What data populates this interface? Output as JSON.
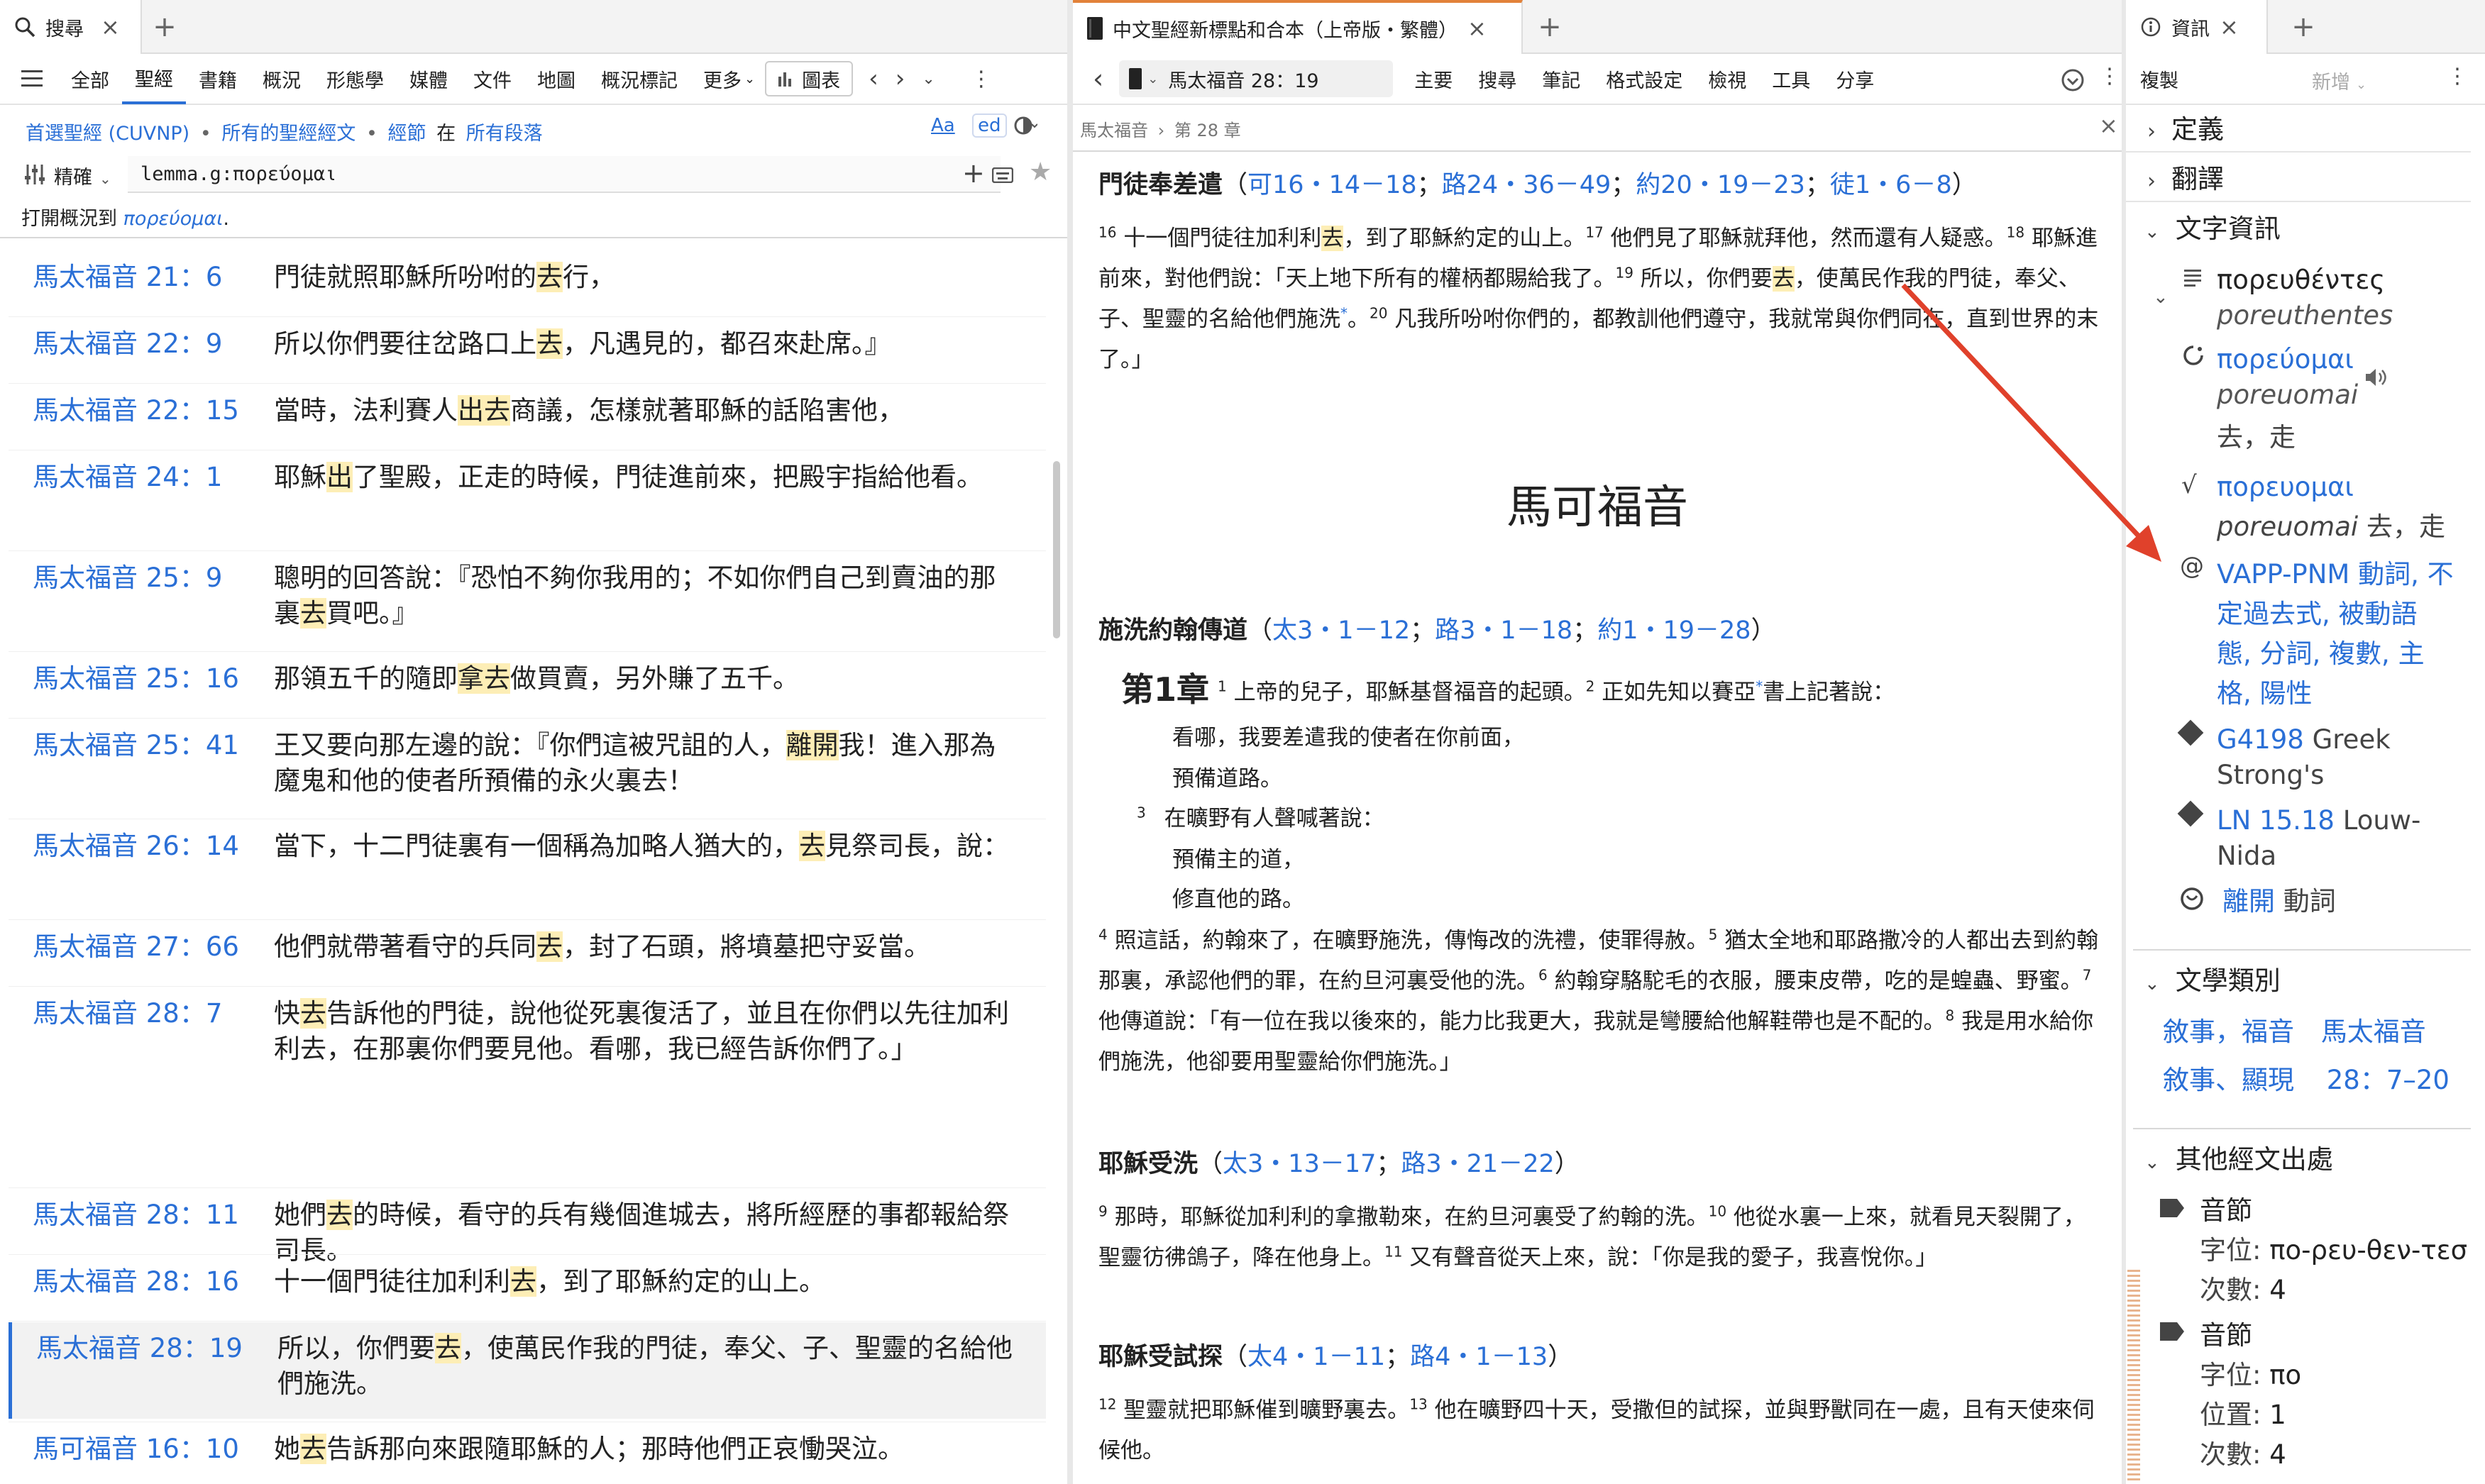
{
  "left": {
    "tab_label": "搜尋",
    "menu": [
      "全部",
      "聖經",
      "書籍",
      "概況",
      "形態學",
      "媒體",
      "文件",
      "地圖",
      "概況標記",
      "更多"
    ],
    "chart_label": "圖表",
    "scope": {
      "bible": "首選聖經 (CUVNP)",
      "sep1": "•",
      "texts": "所有的聖經經文",
      "sep2": "•",
      "scripture": "經節",
      "in": "在",
      "para": "所有段落"
    },
    "aa": "Aa",
    "ed": "ed",
    "search_mode": "精確",
    "query": "lemma.g:πορεύομαι",
    "open_prefix": "打開概況到",
    "open_word": "πορεύομαι",
    "open_suffix": ".",
    "results": [
      {
        "ref": "馬太福音 21：6",
        "pre": "門徒就照耶穌所吩咐的",
        "hl": "去",
        "post": "行，"
      },
      {
        "ref": "馬太福音 22：9",
        "pre": "所以你們要往岔路口上",
        "hl": "去",
        "post": "，凡遇見的，都召來赴席。』"
      },
      {
        "ref": "馬太福音 22：15",
        "pre": "當時，法利賽人",
        "hl": "出去",
        "post": "商議，怎樣就著耶穌的話陷害他，"
      },
      {
        "ref": "馬太福音 24：1",
        "pre": "耶穌",
        "hl": "出",
        "post": "了聖殿，正走的時候，門徒進前來，把殿宇指給他看。"
      },
      {
        "ref": "馬太福音 25：9",
        "pre": "聰明的回答說：『恐怕不夠你我用的；不如你們自己到賣油的那裏",
        "hl": "去",
        "post": "買吧。』"
      },
      {
        "ref": "馬太福音 25：16",
        "pre": "那領五千的隨即",
        "hl": "拿去",
        "post": "做買賣，另外賺了五千。"
      },
      {
        "ref": "馬太福音 25：41",
        "pre": "王又要向那左邊的說：『你們這被咒詛的人，",
        "hl": "離開",
        "post": "我！進入那為魔鬼和他的使者所預備的永火裏去！"
      },
      {
        "ref": "馬太福音 26：14",
        "pre": "當下，十二門徒裏有一個稱為加略人猶大的，",
        "hl": "去",
        "post": "見祭司長，說："
      },
      {
        "ref": "馬太福音 27：66",
        "pre": "他們就帶著看守的兵同",
        "hl": "去",
        "post": "，封了石頭，將墳墓把守妥當。"
      },
      {
        "ref": "馬太福音 28：7",
        "pre": "快",
        "hl": "去",
        "post": "告訴他的門徒，說他從死裏復活了，並且在你們以先往加利利去，在那裏你們要見他。看哪，我已經告訴你們了。」"
      },
      {
        "ref": "馬太福音 28：11",
        "pre": "她們",
        "hl": "去",
        "post": "的時候，看守的兵有幾個進城去，將所經歷的事都報給祭司長。"
      },
      {
        "ref": "馬太福音 28：16",
        "pre": "十一個門徒往加利利",
        "hl": "去",
        "post": "，到了耶穌約定的山上。"
      },
      {
        "ref": "馬太福音 28：19",
        "pre": "所以，你們要",
        "hl": "去",
        "post": "，使萬民作我的門徒，奉父、子、聖靈的名給他們施洗。"
      },
      {
        "ref": "馬可福音 16：10",
        "pre": "她",
        "hl": "去",
        "post": "告訴那向來跟隨耶穌的人；那時他們正哀慟哭泣。"
      }
    ]
  },
  "middle": {
    "tab_label": "中文聖經新標點和合本（上帝版・繁體）",
    "ref_box": "馬太福音 28：19",
    "menu": [
      "主要",
      "搜尋",
      "筆記",
      "格式設定",
      "檢視",
      "工具",
      "分享"
    ],
    "breadcrumb": [
      "馬太福音",
      "第 28 章"
    ],
    "sec1_title": "門徒奉差遣",
    "sec1_refs": [
      "可16・14－18",
      "路24・36－49",
      "約20・19－23",
      "徒1・6－8"
    ],
    "p1": {
      "v16": "16",
      "t16a": "十一個門徒往加利利",
      "h16": "去",
      "t16b": "，到了耶穌約定的山上。",
      "v17": "17",
      "t17": "他們見了耶穌就拜他，然而還有人疑惑。",
      "v18": "18",
      "t18": "耶穌進前來，對他們說：「天上地下所有的權柄都賜給我了。",
      "v19": "19",
      "t19a": "所以，你們要",
      "h19": "去",
      "t19b": "，使萬民作我的門徒，奉父、子、聖靈的名給他們施洗",
      "star": "*",
      "t19c": "。",
      "v20": "20",
      "t20": "凡我所吩咐你們的，都教訓他們遵守，我就常與你們同在，直到世界的末了。」"
    },
    "book_title": "馬可福音",
    "sec2_title": "施洗約翰傳道",
    "sec2_refs": [
      "太3・1－12",
      "路3・1－18",
      "約1・19－28"
    ],
    "chapter_label": "第1章",
    "ch1": {
      "v1": "1",
      "t1": "上帝的兒子，耶穌基督福音的起頭。",
      "v2": "2",
      "t2a": "正如先知以賽亞",
      "star": "*",
      "t2b": "書上記著說：",
      "q1": "看哪，我要差遣我的使者在你前面，",
      "q2": "預備道路。",
      "v3": "3",
      "q3": "在曠野有人聲喊著說：",
      "q4": "預備主的道，",
      "q5": "修直他的路。",
      "v4": "4",
      "t4": "照這話，約翰來了，在曠野施洗，傳悔改的洗禮，使罪得赦。",
      "v5": "5",
      "t5": "猶太全地和耶路撒冷的人都出去到約翰那裏，承認他們的罪，在約旦河裏受他的洗。",
      "v6": "6",
      "t6": "約翰穿駱駝毛的衣服，腰束皮帶，吃的是蝗蟲、野蜜。",
      "v7": "7",
      "t7": "他傳道說：「有一位在我以後來的，能力比我更大，我就是彎腰給他解鞋帶也是不配的。",
      "v8": "8",
      "t8": "我是用水給你們施洗，他卻要用聖靈給你們施洗。」"
    },
    "sec3_title": "耶穌受洗",
    "sec3_refs": [
      "太3・13－17",
      "路3・21－22"
    ],
    "p3": {
      "v9": "9",
      "t9": "那時，耶穌從加利利的拿撒勒來，在約旦河裏受了約翰的洗。",
      "v10": "10",
      "t10": "他從水裏一上來，就看見天裂開了，聖靈彷彿鴿子，降在他身上。",
      "v11": "11",
      "t11": "又有聲音從天上來，說：「你是我的愛子，我喜悅你。」"
    },
    "sec4_title": "耶穌受試探",
    "sec4_refs": [
      "太4・1－11",
      "路4・1－13"
    ],
    "p4": {
      "v12": "12",
      "t12": "聖靈就把耶穌催到曠野裏去。",
      "v13": "13",
      "t13": "他在曠野四十天，受撒但的試探，並與野獸同在一處，且有天使來伺候他。"
    }
  },
  "right": {
    "tab_label": "資訊",
    "copy_label": "複製",
    "new_label": "新增",
    "sections": {
      "definition": "定義",
      "translation": "翻譯",
      "textinfo": "文字資訊",
      "genre": "文學類別",
      "other": "其他經文出處"
    },
    "surface": "πορευθέντες",
    "surface_translit": "poreuthentes",
    "lemma": "πορεύομαι",
    "lemma_translit": "poreuomai",
    "lemma_gloss": "去，走",
    "root": "πορευομαι",
    "root_translit": "poreuomai",
    "root_gloss": "去，走",
    "morph_lines": [
      "VAPP-PNM 動詞, 不",
      "定過去式, 被動語",
      "態, 分詞, 複數, 主",
      "格, 陽性"
    ],
    "strongs_code": "G4198",
    "strongs_label1": "Greek",
    "strongs_label2": "Strong's",
    "ln_code": "LN 15.18",
    "ln_label1": "Louw-",
    "ln_label2": "Nida",
    "sense": "離開",
    "sense_pos": "動詞",
    "genre1": "敘事，福音",
    "genre1b": "馬太福音",
    "genre2": "敘事、顯現",
    "genre2b": "28：7–20",
    "syllable1_title": "音節",
    "syllable1_pos_label": "字位:",
    "syllable1_pos": "πο-ρευ-θεν-τεσ",
    "syllable1_count_label": "次數:",
    "syllable1_count": "4",
    "syllable2_title": "音節",
    "syllable2_pos_label": "字位:",
    "syllable2_pos": "πο",
    "syllable2_place_label": "位置:",
    "syllable2_place": "1",
    "syllable2_count_label": "次數:",
    "syllable2_count": "4"
  },
  "colors": {
    "link": "#2a6fd6",
    "highlight": "#fdeeb6",
    "arrow": "#e0412b",
    "selected_row": "#f2f2f2"
  }
}
